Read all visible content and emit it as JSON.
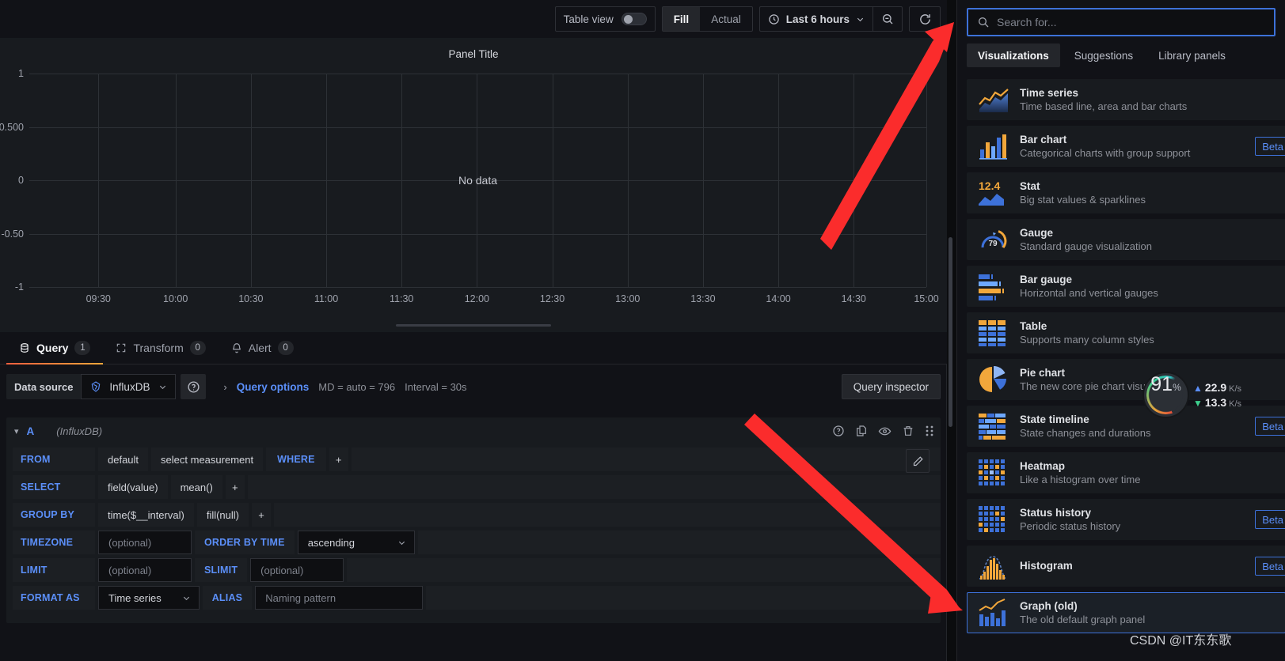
{
  "toolbar": {
    "table_view_label": "Table view",
    "table_view_on": false,
    "fill_label": "Fill",
    "actual_label": "Actual",
    "time_range": "Last 6 hours",
    "clock_icon": "clock-icon",
    "zoom_out_icon": "zoom-out-icon",
    "refresh_icon": "refresh-icon"
  },
  "panel": {
    "title": "Panel Title",
    "no_data": "No data"
  },
  "chart_data": {
    "type": "line",
    "title": "Panel Title",
    "xlabel": "",
    "ylabel": "",
    "series": [],
    "categories": [],
    "values": [],
    "x_ticks": [
      "09:30",
      "10:00",
      "10:30",
      "11:00",
      "11:30",
      "12:00",
      "12:30",
      "13:00",
      "13:30",
      "14:00",
      "14:30",
      "15:00"
    ],
    "y_ticks": [
      "1",
      "0.500",
      "0",
      "-0.50",
      "-1"
    ],
    "ylim": [
      -1,
      1
    ],
    "grid": true,
    "legend": "none",
    "empty_message": "No data"
  },
  "tabs": [
    {
      "label": "Query",
      "count": "1",
      "icon": "database-icon",
      "active": true
    },
    {
      "label": "Transform",
      "count": "0",
      "icon": "transform-icon",
      "active": false
    },
    {
      "label": "Alert",
      "count": "0",
      "icon": "bell-icon",
      "active": false
    }
  ],
  "datasource_row": {
    "label": "Data source",
    "selected": "InfluxDB",
    "help_icon": "help-circle-icon",
    "query_options_label": "Query options",
    "max_data_points": "MD = auto = 796",
    "interval": "Interval = 30s",
    "query_inspector_label": "Query inspector"
  },
  "query": {
    "ref_id": "A",
    "datasource_note": "(InfluxDB)",
    "actions": [
      "help-circle-icon",
      "duplicate-icon",
      "eye-icon",
      "trash-icon",
      "drag-handle-icon"
    ],
    "pencil_icon": "pencil-icon",
    "rows": {
      "from_key": "FROM",
      "from_policy": "default",
      "from_measurement": "select measurement",
      "where_key": "WHERE",
      "plus": "+",
      "select_key": "SELECT",
      "select_field": "field(value)",
      "select_fn": "mean()",
      "groupby_key": "GROUP BY",
      "groupby_time": "time($__interval)",
      "groupby_fill": "fill(null)",
      "timezone_key": "TIMEZONE",
      "timezone_placeholder": "(optional)",
      "orderby_key": "ORDER BY TIME",
      "orderby_value": "ascending",
      "limit_key": "LIMIT",
      "limit_placeholder": "(optional)",
      "slimit_key": "SLIMIT",
      "slimit_placeholder": "(optional)",
      "formatas_key": "FORMAT AS",
      "formatas_value": "Time series",
      "alias_key": "ALIAS",
      "alias_placeholder": "Naming pattern"
    }
  },
  "viz_pane": {
    "search_placeholder": "Search for...",
    "search_value": "",
    "search_icon": "search-icon",
    "tabs": [
      {
        "label": "Visualizations",
        "active": true
      },
      {
        "label": "Suggestions",
        "active": false
      },
      {
        "label": "Library panels",
        "active": false
      }
    ],
    "items": [
      {
        "name": "Time series",
        "desc": "Time based line, area and bar charts",
        "icon": "time-series-icon",
        "badge": "",
        "selected": false
      },
      {
        "name": "Bar chart",
        "desc": "Categorical charts with group support",
        "icon": "bar-chart-icon",
        "badge": "Beta",
        "selected": false
      },
      {
        "name": "Stat",
        "desc": "Big stat values & sparklines",
        "icon": "stat-icon",
        "badge": "",
        "selected": false
      },
      {
        "name": "Gauge",
        "desc": "Standard gauge visualization",
        "icon": "gauge-icon",
        "badge": "",
        "selected": false
      },
      {
        "name": "Bar gauge",
        "desc": "Horizontal and vertical gauges",
        "icon": "bar-gauge-icon",
        "badge": "",
        "selected": false
      },
      {
        "name": "Table",
        "desc": "Supports many column styles",
        "icon": "table-icon",
        "badge": "",
        "selected": false
      },
      {
        "name": "Pie chart",
        "desc": "The new core pie chart visualization",
        "icon": "pie-chart-icon",
        "badge": "",
        "selected": false
      },
      {
        "name": "State timeline",
        "desc": "State changes and durations",
        "icon": "state-timeline-icon",
        "badge": "Beta",
        "selected": false
      },
      {
        "name": "Heatmap",
        "desc": "Like a histogram over time",
        "icon": "heatmap-icon",
        "badge": "",
        "selected": false
      },
      {
        "name": "Status history",
        "desc": "Periodic status history",
        "icon": "status-history-icon",
        "badge": "Beta",
        "selected": false
      },
      {
        "name": "Histogram",
        "desc": "",
        "icon": "histogram-icon",
        "badge": "Beta",
        "selected": false
      },
      {
        "name": "Graph (old)",
        "desc": "The old default graph panel",
        "icon": "graph-old-icon",
        "badge": "",
        "selected": true
      }
    ],
    "gauge_icon_value": "79",
    "stat_icon_value": "12.4"
  },
  "net_widget": {
    "percent": "91",
    "percent_unit": "%",
    "upload": "22.9",
    "upload_unit": "K/s",
    "download": "13.3",
    "download_unit": "K/s"
  },
  "watermark": "CSDN @IT东东歌",
  "colors": {
    "accent_blue": "#3d71d9",
    "link_blue": "#5b8ff9",
    "orange": "#f2a73b",
    "panel_bg": "#181b1f",
    "app_bg": "#111217",
    "annotation_red": "#fb2c2c"
  }
}
